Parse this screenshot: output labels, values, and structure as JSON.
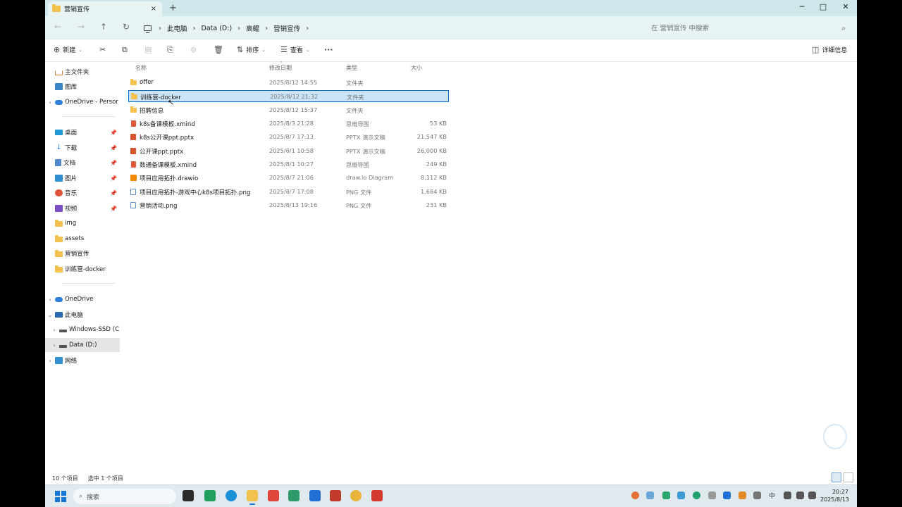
{
  "window": {
    "tab_title": "营销宣传",
    "tab_close": "×",
    "new_tab": "+",
    "controls": {
      "minimize": "─",
      "maximize": "□",
      "close": "✕"
    }
  },
  "nav": {
    "back": "←",
    "forward": "→",
    "up": "↑",
    "refresh": "↻"
  },
  "breadcrumb": [
    "此电脑",
    "Data (D:)",
    "高鲲",
    "营销宣传"
  ],
  "search": {
    "placeholder": "在 营销宣传 中搜索"
  },
  "toolbar": {
    "new_label": "新建",
    "sort_label": "排序",
    "view_label": "查看",
    "more": "···",
    "details_label": "详细信息"
  },
  "sidebar": {
    "quick": [
      {
        "label": "主文件夹",
        "icon": "home-icon"
      },
      {
        "label": "图库",
        "icon": "gallery-icon"
      },
      {
        "label": "OneDrive - Persor",
        "icon": "cloud-icon"
      }
    ],
    "pinned": [
      {
        "label": "桌面",
        "icon": "desktop-icon"
      },
      {
        "label": "下载",
        "icon": "download-icon"
      },
      {
        "label": "文档",
        "icon": "documents-icon"
      },
      {
        "label": "图片",
        "icon": "pictures-icon"
      },
      {
        "label": "音乐",
        "icon": "music-icon"
      },
      {
        "label": "视频",
        "icon": "videos-icon"
      },
      {
        "label": "img",
        "icon": "folder-icon"
      },
      {
        "label": "assets",
        "icon": "folder-icon"
      },
      {
        "label": "营销宣传",
        "icon": "folder-icon"
      },
      {
        "label": "训练营-docker",
        "icon": "folder-icon"
      }
    ],
    "tree": [
      {
        "label": "OneDrive",
        "icon": "cloud-icon"
      },
      {
        "label": "此电脑",
        "icon": "pc-icon"
      },
      {
        "label": "Windows-SSD (C",
        "icon": "drive-icon"
      },
      {
        "label": "Data (D:)",
        "icon": "drive-icon"
      },
      {
        "label": "网络",
        "icon": "network-icon"
      }
    ]
  },
  "columns": {
    "name": "名称",
    "date": "修改日期",
    "type": "类型",
    "size": "大小"
  },
  "files": [
    {
      "name": "offer",
      "date": "2025/8/12 14:55",
      "type": "文件夹",
      "size": "",
      "icon": "folder-icon"
    },
    {
      "name": "训练营-docker",
      "date": "2025/8/12 21:32",
      "type": "文件夹",
      "size": "",
      "icon": "folder-icon"
    },
    {
      "name": "招聘信息",
      "date": "2025/8/12 15:37",
      "type": "文件夹",
      "size": "",
      "icon": "folder-icon"
    },
    {
      "name": "k8s备课模板.xmind",
      "date": "2025/8/3 21:28",
      "type": "思维导图",
      "size": "53 KB",
      "icon": "xmind-icon"
    },
    {
      "name": "k8s公开课ppt.pptx",
      "date": "2025/8/7 17:13",
      "type": "PPTX 演示文稿",
      "size": "21,547 KB",
      "icon": "pptx-icon"
    },
    {
      "name": "公开课ppt.pptx",
      "date": "2025/8/1 10:58",
      "type": "PPTX 演示文稿",
      "size": "26,000 KB",
      "icon": "pptx-icon"
    },
    {
      "name": "数通备课模板.xmind",
      "date": "2025/8/1 10:27",
      "type": "思维导图",
      "size": "249 KB",
      "icon": "xmind-icon"
    },
    {
      "name": "项目应用拓扑.drawio",
      "date": "2025/8/7 21:06",
      "type": "draw.io Diagram",
      "size": "8,112 KB",
      "icon": "drawio-icon"
    },
    {
      "name": "项目应用拓扑-游戏中心k8s项目拓扑.png",
      "date": "2025/8/7 17:08",
      "type": "PNG 文件",
      "size": "1,684 KB",
      "icon": "png-icon"
    },
    {
      "name": "营销活动.png",
      "date": "2025/8/13 19:16",
      "type": "PNG 文件",
      "size": "231 KB",
      "icon": "png-icon"
    }
  ],
  "status": {
    "count": "10 个项目",
    "selected": "选中 1 个项目"
  },
  "taskbar": {
    "search_label": "搜索",
    "ime": "中",
    "time": "20:27",
    "date": "2025/8/13"
  },
  "colors": {
    "accent": "#0f6cbd",
    "selection": "#cce4f7",
    "titlebar": "#cfe7ea",
    "folder": "#f2c14e"
  }
}
